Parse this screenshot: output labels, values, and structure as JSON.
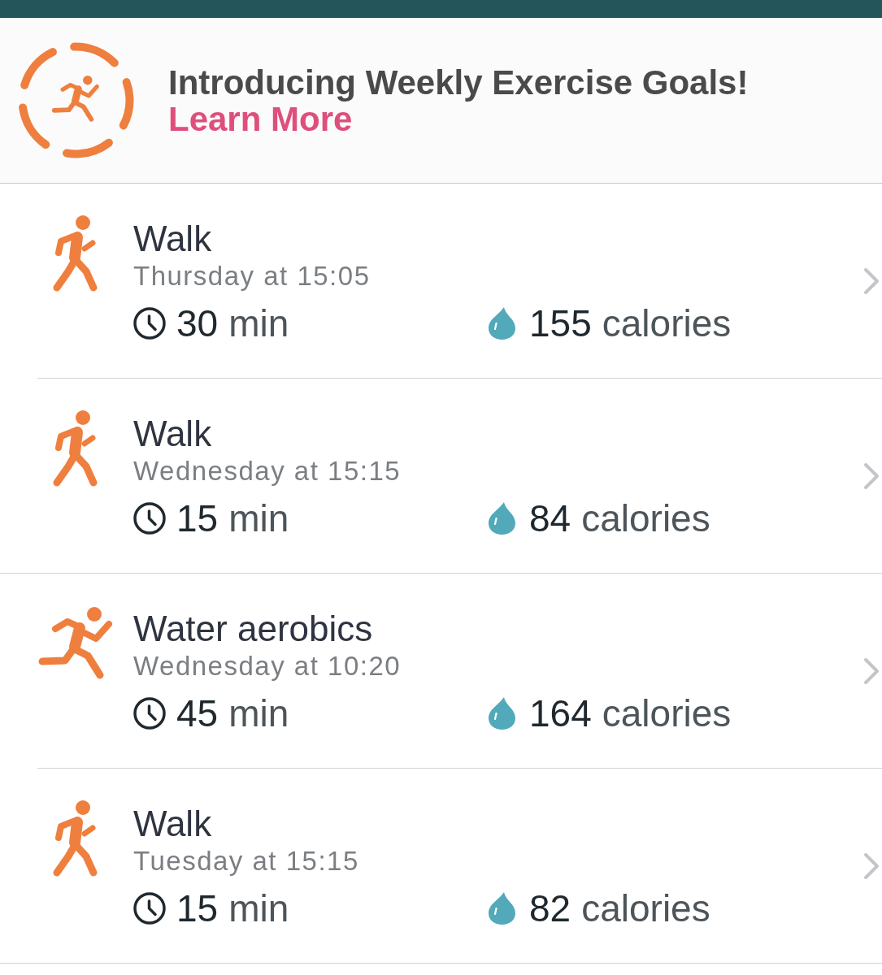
{
  "banner": {
    "text": "Introducing Weekly Exercise Goals!",
    "link": "Learn More"
  },
  "workouts": [
    {
      "kind": "walk",
      "title": "Walk",
      "when": "Thursday at 15:05",
      "duration": {
        "value": "30",
        "unit": "min"
      },
      "calories": {
        "value": "155",
        "unit": "calories"
      },
      "divider_inset": true
    },
    {
      "kind": "walk",
      "title": "Walk",
      "when": "Wednesday at 15:15",
      "duration": {
        "value": "15",
        "unit": "min"
      },
      "calories": {
        "value": "84",
        "unit": "calories"
      },
      "divider_inset": false
    },
    {
      "kind": "run",
      "title": "Water aerobics",
      "when": "Wednesday at 10:20",
      "duration": {
        "value": "45",
        "unit": "min"
      },
      "calories": {
        "value": "164",
        "unit": "calories"
      },
      "divider_inset": true
    },
    {
      "kind": "walk",
      "title": "Walk",
      "when": "Tuesday at 15:15",
      "duration": {
        "value": "15",
        "unit": "min"
      },
      "calories": {
        "value": "82",
        "unit": "calories"
      },
      "divider_inset": false
    }
  ]
}
